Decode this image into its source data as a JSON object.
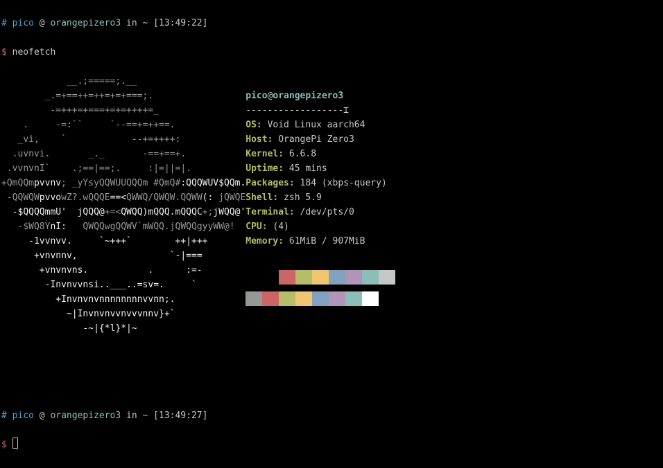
{
  "prompt1": {
    "hash": "#",
    "user": "pico",
    "at": "@",
    "host": "orangepizero3",
    "in_word": "in",
    "path": "~",
    "time": "[13:49:22]",
    "dollar": "$",
    "cmd": "neofetch"
  },
  "ascii": "            __.;=====;.__\n        _.=+==++=++=+=+===;.\n         -=+++=+===+=+=++++=_\n    .     -=:``     `--==+=++==.\n   _vi,    `            --+=++++:\n  .uvnvi.       _._       -==+==+.\n .vvnvnI`    .;==|==;.     :|=||=|.\n+QmQQm\u001bpvvnv\u001b; _yYsyQQWUUQQQm #QmQ#\u001b:QQQWUV$QQm.\u001b\n -QQWQW\u001bpvvo\u001bwZ?.wQQQE\u001b==<\u001bQWWQ/QWQW.QQWW\u001b(:\u001b jQWQE\u001b\n  -$QQQQmmU'  jQQQ@\u001b+=<\u001bQWQQ)mQQQ.mQQQC\u001b+;\u001bjWQQ@'\u001b\n   -$WQ8Y\u001bnI:\u001b   QWQQwgQQWV`mWQQ.jQWQQgyyWW@!\u001b\n     -1vvnvv.     `~+++`        ++|+++\n      +vnvnnv,                 `-|===\n       +vnvnvns.           .      :=-\n        -Invnvvnsi..___..=sv=.     `\n          +Invnvnvnnnnnnnnvvnn;.\n            ~|Invnvnvvnvvvnnv}+`\n               -~|{*l}*|~",
  "info": {
    "user": "pico",
    "at": "@",
    "host": "orangepizero3",
    "dashes": "------------------",
    "cursor_char": "⌶",
    "fields": [
      {
        "label": "OS:",
        "value": " Void Linux aarch64"
      },
      {
        "label": "Host:",
        "value": " OrangePi Zero3"
      },
      {
        "label": "Kernel:",
        "value": " 6.6.8"
      },
      {
        "label": "Uptime:",
        "value": " 45 mins"
      },
      {
        "label": "Packages:",
        "value": " 184 (xbps-query)"
      },
      {
        "label": "Shell:",
        "value": " zsh 5.9"
      },
      {
        "label": "Terminal:",
        "value": " /dev/pts/0"
      },
      {
        "label": "CPU:",
        "value": " (4)"
      },
      {
        "label": "Memory:",
        "value": " 61MiB / 907MiB"
      }
    ]
  },
  "colors1": [
    "#000000",
    "#cc6666",
    "#b5bd68",
    "#f0c674",
    "#81a2be",
    "#b294bb",
    "#8abeb7",
    "#c5c8c6"
  ],
  "colors2": [
    "#969896",
    "#cc6666",
    "#b5bd68",
    "#f0c674",
    "#81a2be",
    "#b294bb",
    "#8abeb7",
    "#ffffff"
  ],
  "prompt2": {
    "hash": "#",
    "user": "pico",
    "at": "@",
    "host": "orangepizero3",
    "in_word": "in",
    "path": "~",
    "time": "[13:49:27]",
    "dollar": "$"
  }
}
